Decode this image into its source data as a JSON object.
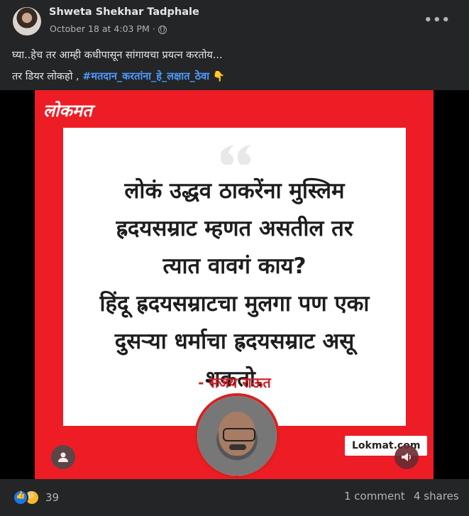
{
  "post": {
    "author": "Shweta Shekhar Tadphale",
    "timestamp": "October 18 at 4:03 PM",
    "separator": "·",
    "caption_line1": "घ्या..हेच तर आम्ही कधीपासून  सांगायचा प्रयत्न करतोय...",
    "caption_line2_prefix": "तर डियर लोकहो , ",
    "caption_hashtag": "#मतदान_करतांना_हे_लक्षात_ठेवा",
    "caption_emoji": "👇"
  },
  "image": {
    "logo": "लोकमत",
    "quote": "लोकं उद्धव ठाकरेंना मुस्लिम ह्रदयसम्राट म्हणत असतील तर त्यात वावगं काय? हिंदू ह्रदयसम्राटचा मुलगा पण एका दुसऱ्या धर्माचा ह्रदयसम्राट असू शकतो.",
    "quote_lines": [
      "लोकं उद्धव ठाकरेंना मुस्लिम",
      "ह्रदयसम्राट म्हणत असतील तर",
      "त्यात वावगं काय?",
      "हिंदू ह्रदयसम्राटचा मुलगा पण एका",
      "दुसऱ्या धर्माचा ह्रदयसम्राट असू",
      "शकतो."
    ],
    "author": "- संजय राऊत",
    "watermark": "Lokmat.com"
  },
  "footer": {
    "reaction_count": "39",
    "comments": "1 comment",
    "shares": "4 shares"
  },
  "colors": {
    "page_bg": "#242526",
    "brand_red": "#ee1c25",
    "link_blue": "#4d9bff"
  },
  "icons": {
    "like": "like-icon",
    "haha": "haha-icon",
    "profile": "profile-icon",
    "sound": "sound-icon",
    "globe": "globe-icon",
    "more": "more-options-icon"
  }
}
